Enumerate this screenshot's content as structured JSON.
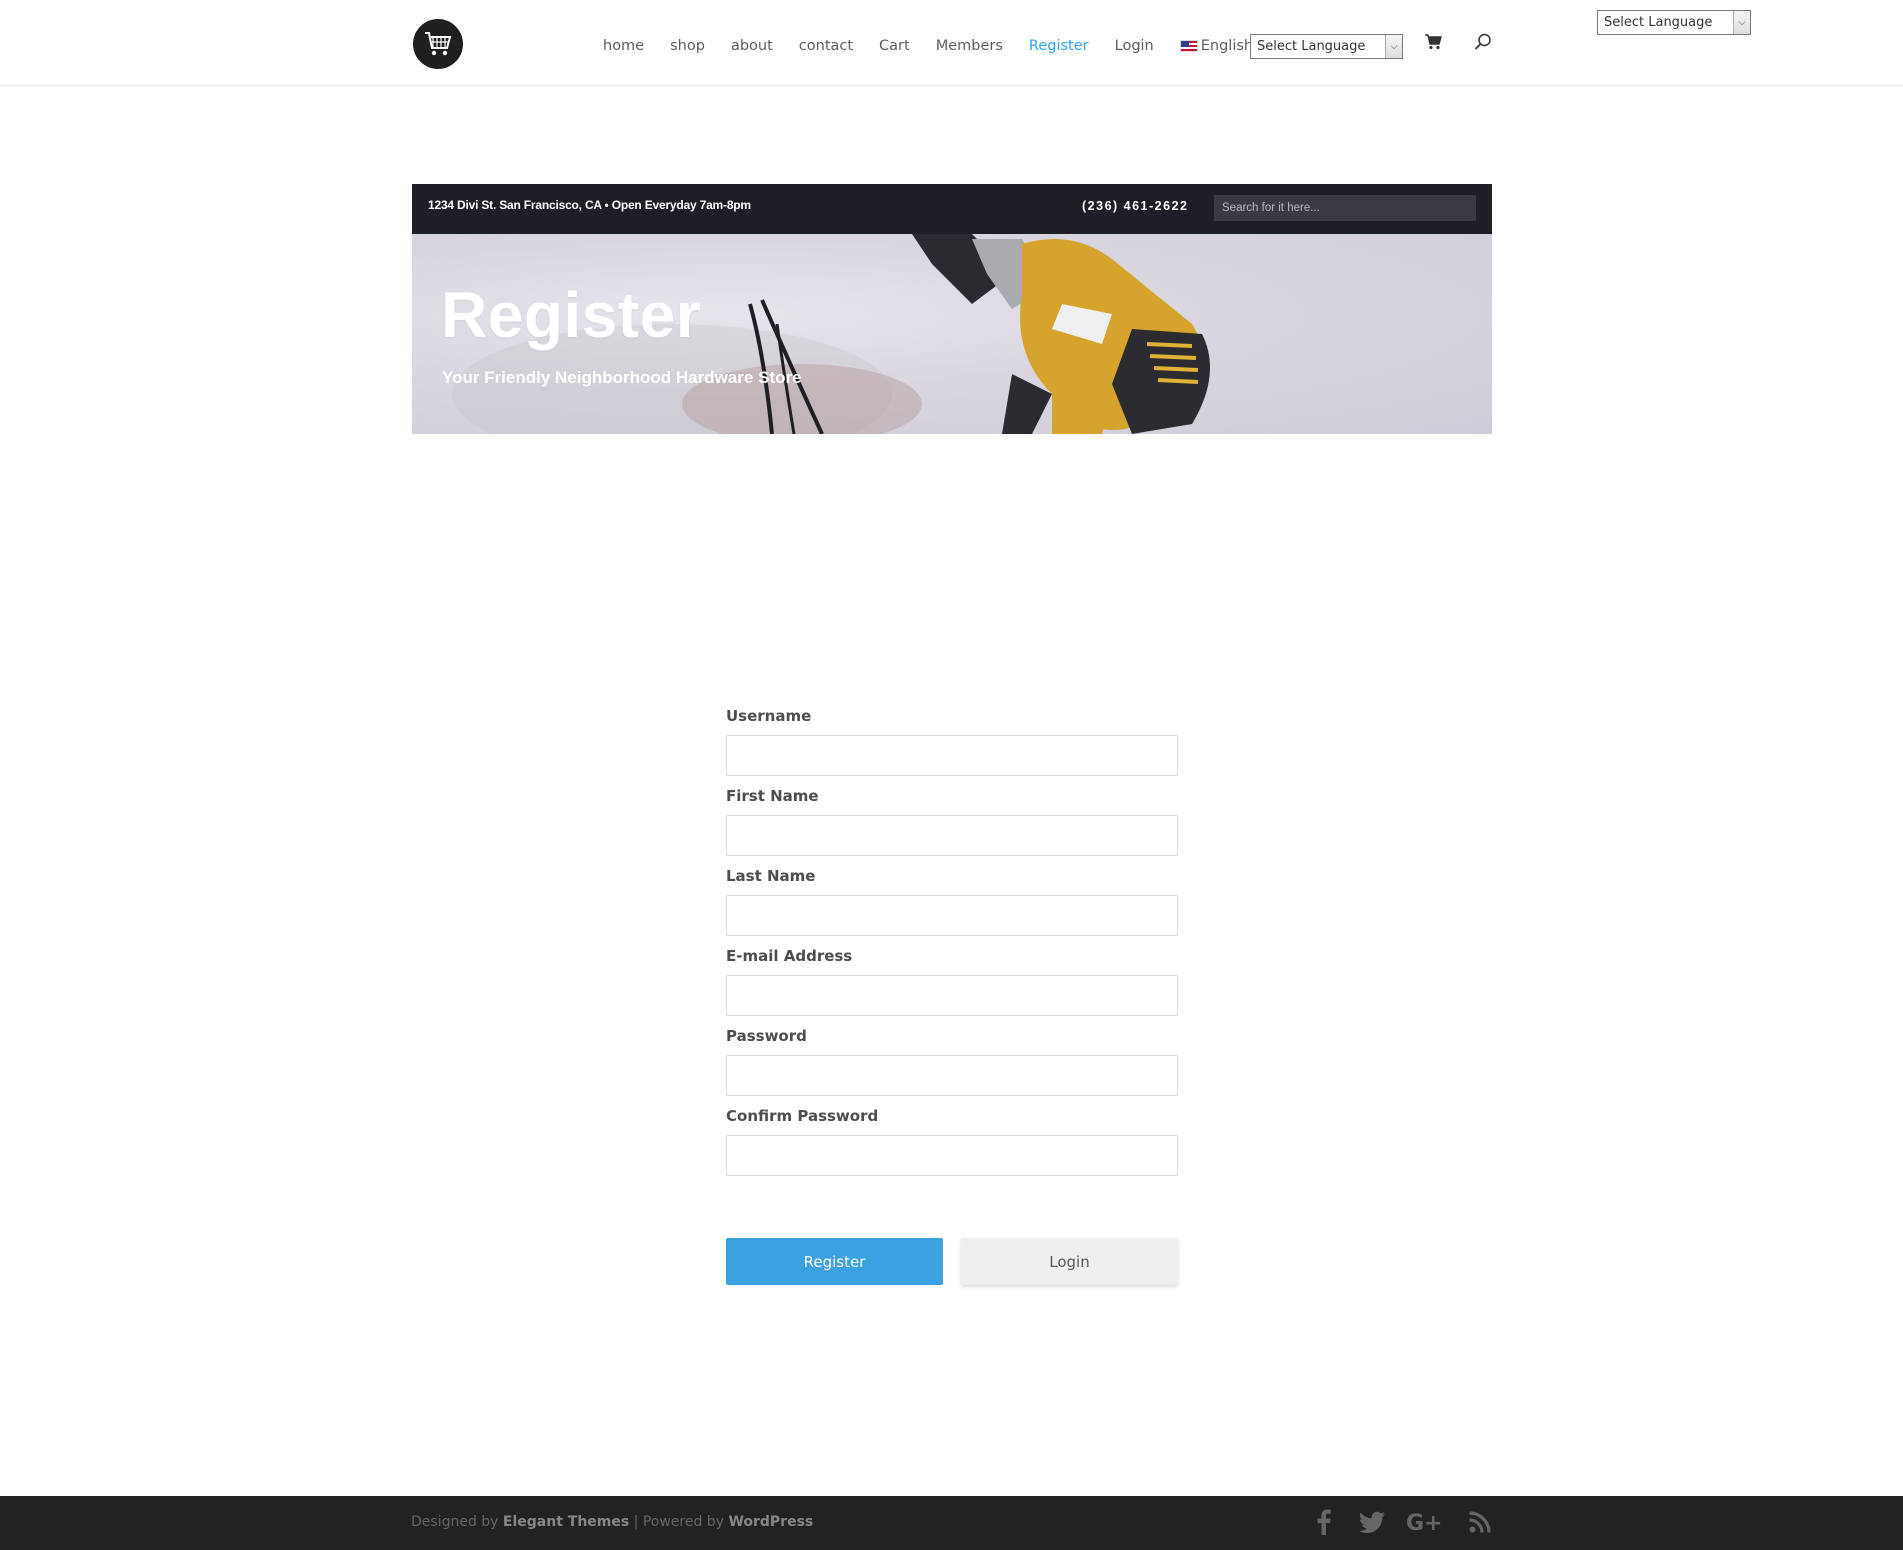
{
  "header": {
    "logo_name": "shopping-cart-logo",
    "nav": [
      {
        "label": "home"
      },
      {
        "label": "shop"
      },
      {
        "label": "about"
      },
      {
        "label": "contact"
      },
      {
        "label": "Cart"
      },
      {
        "label": "Members"
      },
      {
        "label": "Register",
        "active": true
      },
      {
        "label": "Login"
      }
    ],
    "language_label": "English",
    "language_select": "Select Language",
    "corner_language_select": "Select Language"
  },
  "banner": {
    "address": "1234 Divi St. San Francisco, CA • Open Everyday 7am-8pm",
    "phone": "(236) 461-2622",
    "search_placeholder": "Search for it here...",
    "title": "Register",
    "subtitle": "Your Friendly Neighborhood Hardware Store"
  },
  "form": {
    "fields": [
      {
        "label": "Username",
        "value": ""
      },
      {
        "label": "First Name",
        "value": ""
      },
      {
        "label": "Last Name",
        "value": ""
      },
      {
        "label": "E-mail Address",
        "value": ""
      },
      {
        "label": "Password",
        "value": ""
      },
      {
        "label": "Confirm Password",
        "value": ""
      }
    ],
    "register_button": "Register",
    "login_button": "Login"
  },
  "footer": {
    "designed_by_prefix": "Designed by",
    "designed_by": "Elegant Themes",
    "separator": "| Powered by",
    "powered_by": "WordPress",
    "socials": [
      "facebook-icon",
      "twitter-icon",
      "google-plus-icon",
      "rss-icon"
    ]
  },
  "colors": {
    "accent": "#2ea3f2",
    "register_button": "#3ba1e0",
    "topbar": "#1e1f26",
    "footer": "#222222"
  }
}
